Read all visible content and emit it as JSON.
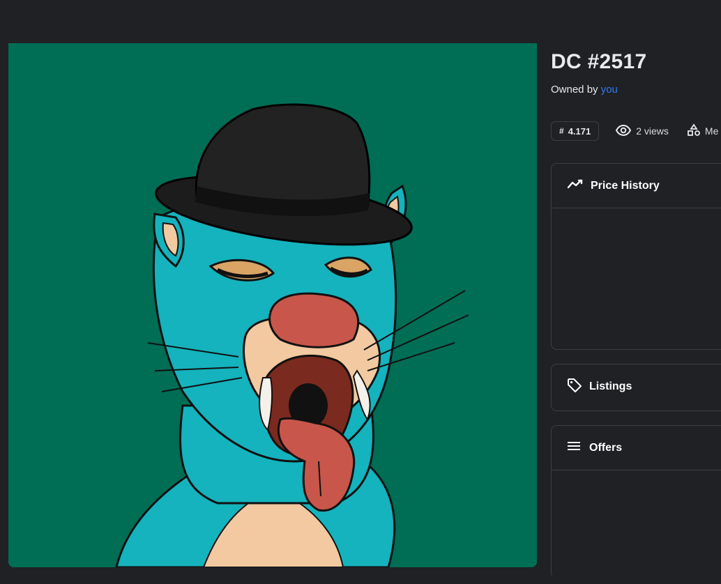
{
  "nft": {
    "title": "DC #2517",
    "owner_prefix": "Owned by",
    "owner_name": "you",
    "rank_symbol": "#",
    "rank_value": "4.171",
    "views_text": "2 views",
    "meta_text": "Me"
  },
  "panels": {
    "price_history": "Price History",
    "listings": "Listings",
    "offers": "Offers"
  },
  "icons": {
    "rank": "hash-icon",
    "views": "eye-icon",
    "meta": "shapes-icon",
    "price_history": "trend-line-icon",
    "listings": "tag-icon",
    "offers": "list-icon"
  },
  "colors": {
    "background": "#202124",
    "art_background": "#006d55",
    "link": "#2f7bf5",
    "border": "#3c4043"
  }
}
